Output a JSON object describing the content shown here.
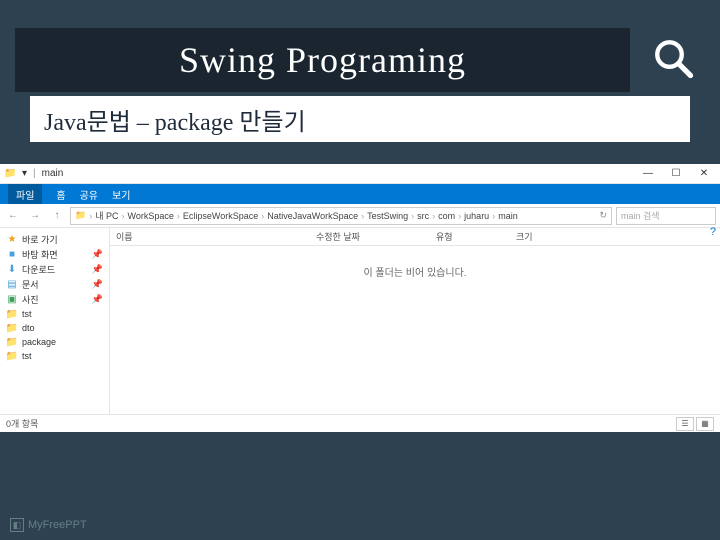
{
  "slide": {
    "title": "Swing Programing",
    "subtitle": "Java문법 – package 만들기",
    "footer": "MyFreePPT"
  },
  "explorer": {
    "titlebar": {
      "folder": "main"
    },
    "ribbon": {
      "file": "파일",
      "home": "홈",
      "share": "공유",
      "view": "보기"
    },
    "breadcrumb": [
      "내 PC",
      "WorkSpace",
      "EclipseWorkSpace",
      "NativeJavaWorkSpace",
      "TestSwing",
      "src",
      "com",
      "juharu",
      "main"
    ],
    "search_placeholder": "main 검색",
    "sidebar": {
      "quick": "바로 가기",
      "items": [
        {
          "label": "바탕 화면",
          "pin": true
        },
        {
          "label": "다운로드",
          "pin": true
        },
        {
          "label": "문서",
          "pin": true
        },
        {
          "label": "사진",
          "pin": true
        },
        {
          "label": "tst",
          "pin": false
        },
        {
          "label": "dto",
          "pin": false
        },
        {
          "label": "package",
          "pin": false
        },
        {
          "label": "tst",
          "pin": false
        }
      ]
    },
    "columns": {
      "name": "이름",
      "date": "수정한 날짜",
      "type": "유형",
      "size": "크기"
    },
    "empty": "이 폴더는 비어 있습니다.",
    "status": "0개 항목"
  }
}
